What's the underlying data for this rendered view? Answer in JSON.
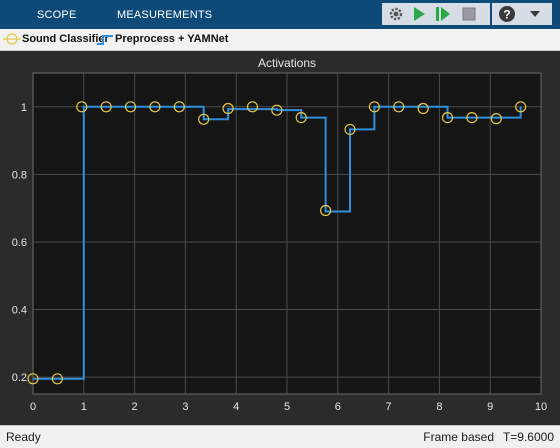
{
  "toolstrip": {
    "tabs": [
      "SCOPE",
      "MEASUREMENTS"
    ],
    "quick_access_icons": [
      "settings-gear-icon",
      "run-icon",
      "step-forward-icon",
      "stop-icon",
      "help-icon",
      "dropdown-arrow-icon"
    ]
  },
  "legend": {
    "items": [
      "Sound Classifier",
      "Preprocess + YAMNet"
    ]
  },
  "chart_data": {
    "type": "line",
    "title": "Activations",
    "xlabel": "",
    "ylabel": "",
    "xlim": [
      0,
      10
    ],
    "ylim": [
      0.15,
      1.1
    ],
    "x_ticks": [
      "0",
      "1",
      "2",
      "3",
      "4",
      "5",
      "6",
      "7",
      "8",
      "9",
      "10"
    ],
    "y_ticks": [
      "0.2",
      "0.4",
      "0.6",
      "0.8",
      "1"
    ],
    "grid": true,
    "legend_position": "top-left",
    "series": [
      {
        "name": "Sound Classifier",
        "style": "markers",
        "x": [
          0,
          0.48,
          0.96,
          1.44,
          1.92,
          2.4,
          2.88,
          3.36,
          3.84,
          4.32,
          4.8,
          5.28,
          5.76,
          6.24,
          6.72,
          7.2,
          7.68,
          8.16,
          8.64,
          9.12,
          9.6
        ],
        "y": [
          0.195,
          0.195,
          1.0,
          1.0,
          1.0,
          1.0,
          1.0,
          0.963,
          0.995,
          1.0,
          0.99,
          0.968,
          0.693,
          0.933,
          1.0,
          1.0,
          0.995,
          0.968,
          0.968,
          0.965,
          1.0
        ]
      },
      {
        "name": "Preprocess + YAMNet",
        "style": "stairs",
        "x": [
          0,
          0.96,
          1.0,
          3.36,
          3.84,
          4.8,
          5.28,
          5.76,
          6.24,
          6.72,
          8.16,
          9.6
        ],
        "y": [
          0.195,
          0.195,
          1.0,
          0.963,
          0.993,
          0.99,
          0.968,
          0.69,
          0.933,
          1.0,
          0.968,
          1.0
        ]
      }
    ],
    "colors": {
      "markers": "#e5c845",
      "stairs": "#2f8fdc",
      "axes_bg": "#151515",
      "figure_bg": "#2b2b2b",
      "grid": "#4a4a4a",
      "text": "#e6e6e6"
    }
  },
  "status": {
    "left": "Ready",
    "mode": "Frame based",
    "time": "T=9.6000"
  }
}
